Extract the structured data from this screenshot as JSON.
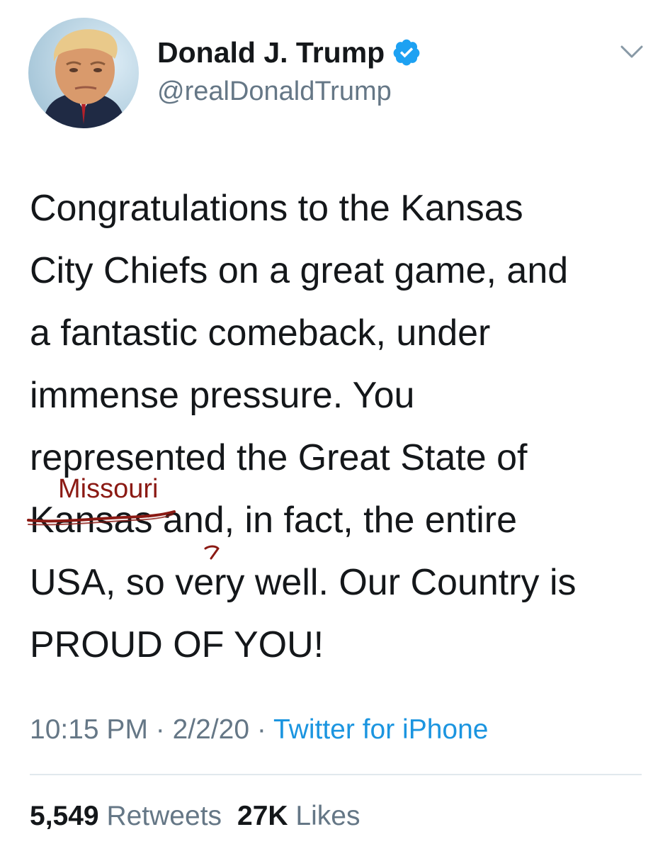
{
  "author": {
    "display_name": "Donald J. Trump",
    "handle": "@realDonaldTrump",
    "verified": true
  },
  "tweet": {
    "lines": [
      "Congratulations to the Kansas",
      "City Chiefs on a great game, and",
      "a fantastic comeback, under",
      "immense pressure. You",
      "represented the Great State of",
      "",
      "USA, so very well. Our Country is",
      "PROUD OF YOU!"
    ],
    "struck_word": "Kansas",
    "line6_rest": " and, in fact, the entire",
    "line7_before": "USA, so ",
    "line7_after": "very well. Our Country is",
    "handwritten_correction": "Missouri"
  },
  "meta": {
    "time": "10:15 PM",
    "separator": " · ",
    "date": "2/2/20",
    "source": "Twitter for iPhone"
  },
  "stats": {
    "retweets_count": "5,549",
    "retweets_label": "Retweets",
    "likes_count": "27K",
    "likes_label": "Likes"
  },
  "colors": {
    "text": "#14171a",
    "secondary": "#657786",
    "link": "#1b95e0",
    "verified": "#1da1f2",
    "annotation": "#8b1a14"
  },
  "icons": {
    "verified": "verified-badge-icon",
    "more": "chevron-down-icon"
  }
}
